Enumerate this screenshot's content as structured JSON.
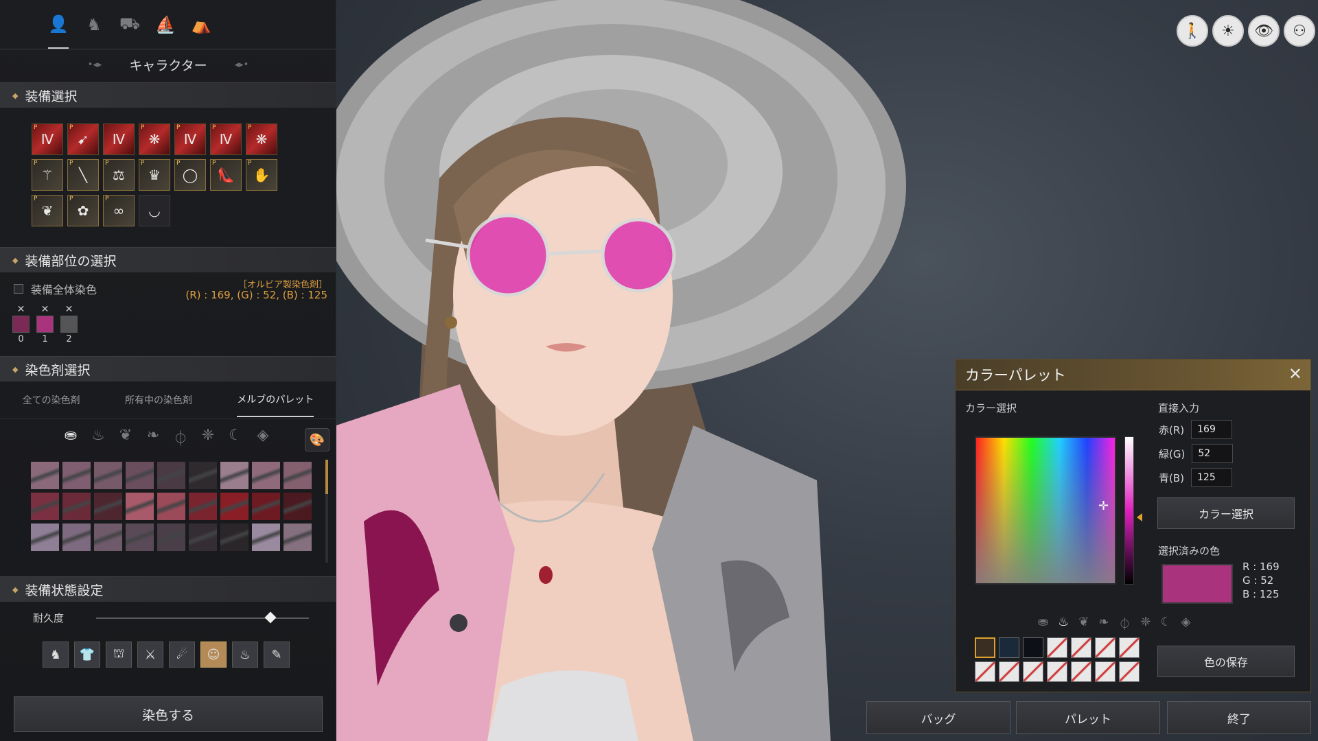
{
  "top_tabs": [
    {
      "icon": "person-icon",
      "glyph": "👤"
    },
    {
      "icon": "horse-icon",
      "glyph": "♞"
    },
    {
      "icon": "wagon-icon",
      "glyph": "⛟"
    },
    {
      "icon": "boat-icon",
      "glyph": "⛵"
    },
    {
      "icon": "tent-icon",
      "glyph": "⛺"
    }
  ],
  "header": {
    "title": "キャラクター",
    "left_arrow": "•◂▸",
    "right_arrow": "◂▸•"
  },
  "sections": {
    "equipment": "装備選択",
    "parts": "装備部位の選択",
    "dye": "染色剤選択",
    "state": "装備状態設定"
  },
  "equipment_slots": [
    {
      "style": "red",
      "glyph": "Ⅳ",
      "p": true
    },
    {
      "style": "red",
      "glyph": "➹",
      "p": true
    },
    {
      "style": "red",
      "glyph": "Ⅳ",
      "p": false
    },
    {
      "style": "red",
      "glyph": "❋",
      "p": true
    },
    {
      "style": "red",
      "glyph": "Ⅳ",
      "p": true
    },
    {
      "style": "red",
      "glyph": "Ⅳ",
      "p": true
    },
    {
      "style": "red",
      "glyph": "❋",
      "p": true
    },
    {
      "style": "gold",
      "glyph": "⚚",
      "p": true
    },
    {
      "style": "gold",
      "glyph": "╲",
      "p": true
    },
    {
      "style": "gold",
      "glyph": "⚖",
      "p": true
    },
    {
      "style": "gold",
      "glyph": "♛",
      "p": true
    },
    {
      "style": "gold",
      "glyph": "◯",
      "p": true
    },
    {
      "style": "gold",
      "glyph": "👠",
      "p": true
    },
    {
      "style": "gold",
      "glyph": "✋",
      "p": true
    },
    {
      "style": "gold",
      "glyph": "❦",
      "p": true
    },
    {
      "style": "gold",
      "glyph": "✿",
      "p": true
    },
    {
      "style": "gold",
      "glyph": "∞",
      "p": true
    },
    {
      "style": "dark",
      "glyph": "◡",
      "p": false
    }
  ],
  "parts": {
    "checkbox_label": "装備全体染色",
    "dye_name": "［オルビア製染色剤］",
    "dye_value": "(R) : 169, (G) : 52, (B) : 125",
    "swatches": [
      {
        "x": "✕",
        "color": "#7a2a55",
        "num": "0"
      },
      {
        "x": "✕",
        "color": "#a9347d",
        "num": "1"
      },
      {
        "x": "✕",
        "color": "#555558",
        "num": "2"
      }
    ]
  },
  "dye_tabs": [
    "全ての染色剤",
    "所有中の染色剤",
    "メルブのパレット"
  ],
  "dye_materials": [
    {
      "icon": "cloth-icon",
      "glyph": "⛂",
      "on": true
    },
    {
      "icon": "leather-icon",
      "glyph": "♨",
      "on": false
    },
    {
      "icon": "feather-icon",
      "glyph": "❦",
      "on": false
    },
    {
      "icon": "fur-icon",
      "glyph": "❧",
      "on": false
    },
    {
      "icon": "metal-icon",
      "glyph": "⏀",
      "on": false
    },
    {
      "icon": "wing-icon",
      "glyph": "❈",
      "on": false
    },
    {
      "icon": "moon-icon",
      "glyph": "☾",
      "on": false
    },
    {
      "icon": "gem-icon",
      "glyph": "◈",
      "on": false
    }
  ],
  "palette_icon": "🎨",
  "dye_colors": [
    "#8a6a7a",
    "#7e5e70",
    "#765a6a",
    "#6a4e5e",
    "#4a3a44",
    "#2e2a2e",
    "#9a7e8e",
    "#8e6a7a",
    "#84606e",
    "#7a3040",
    "#6a2a38",
    "#4e2630",
    "#a85a6a",
    "#9a4a58",
    "#7a2430",
    "#8a1e26",
    "#6e1a22",
    "#4a1a20",
    "#8e7e96",
    "#7e6a80",
    "#6e5a6a",
    "#5a4a58",
    "#4a3e48",
    "#342e34",
    "#2a262a",
    "#9a8aa0",
    "#84707e"
  ],
  "state": {
    "durability_label": "耐久度",
    "durability": 0.82,
    "buttons": [
      {
        "icon": "helmet-icon",
        "glyph": "♞",
        "active": false
      },
      {
        "icon": "armor-icon",
        "glyph": "👕",
        "active": false
      },
      {
        "icon": "cloak-icon",
        "glyph": "⛫",
        "active": false
      },
      {
        "icon": "weapon-pose-icon",
        "glyph": "⚔",
        "active": false
      },
      {
        "icon": "action-pose-icon",
        "glyph": "☄",
        "active": false
      },
      {
        "icon": "face-icon",
        "glyph": "☺",
        "active": true
      },
      {
        "icon": "underwear-icon",
        "glyph": "♨",
        "active": false
      },
      {
        "icon": "brush-icon",
        "glyph": "✎",
        "active": false
      }
    ]
  },
  "dye_button": "染色する",
  "top_right_icons": [
    {
      "icon": "pose-icon",
      "glyph": "🚶"
    },
    {
      "icon": "light-icon",
      "glyph": "☀"
    },
    {
      "icon": "eye-icon",
      "glyph": "👁"
    },
    {
      "icon": "camera-icon",
      "glyph": "⚇"
    }
  ],
  "color_palette": {
    "title": "カラーパレット",
    "close": "✕",
    "select_label": "カラー選択",
    "direct_input": "直接入力",
    "r_label": "赤(R)",
    "r": "169",
    "g_label": "緑(G)",
    "g": "52",
    "b_label": "青(B)",
    "b": "125",
    "select_button": "カラー選択",
    "selected_label": "選択済みの色",
    "selected_color": "#a9347d",
    "sel_r": "R : 169",
    "sel_g": "G : 52",
    "sel_b": "B : 125",
    "save_button": "色の保存",
    "saved_colors": [
      "#3a2e22",
      "#1a2a3a",
      "#0e1018"
    ]
  },
  "bottom_buttons": [
    "バッグ",
    "パレット",
    "終了"
  ]
}
